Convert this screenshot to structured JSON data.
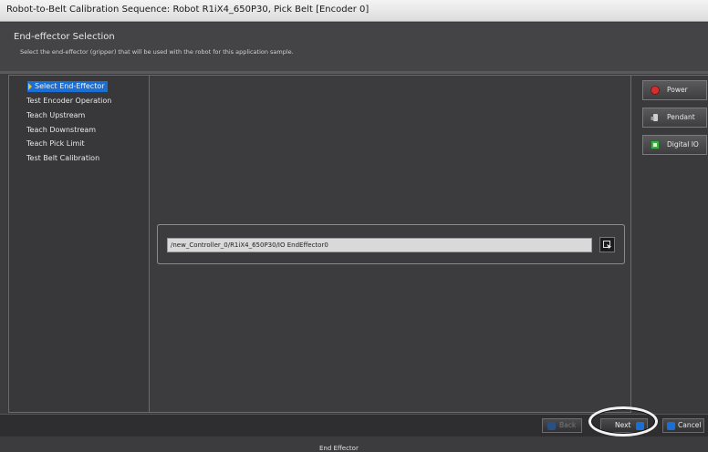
{
  "window": {
    "title": "Robot-to-Belt Calibration Sequence: Robot R1iX4_650P30, Pick Belt [Encoder 0]"
  },
  "header": {
    "title": "End-effector Selection",
    "description": "Select the end-effector (gripper) that will be used with the robot for this application sample."
  },
  "steps": [
    {
      "label": "Select End-Effector",
      "selected": true
    },
    {
      "label": "Test Encoder Operation",
      "selected": false
    },
    {
      "label": "Teach Upstream",
      "selected": false
    },
    {
      "label": "Teach Downstream",
      "selected": false
    },
    {
      "label": "Teach Pick Limit",
      "selected": false
    },
    {
      "label": "Test Belt Calibration",
      "selected": false
    }
  ],
  "end_effector": {
    "group_label": "End Effector",
    "value": "/new_Controller_0/R1iX4_650P30/IO EndEffector0",
    "browse_icon": "browse-icon"
  },
  "side_buttons": {
    "power": {
      "label": "Power",
      "icon": "power-icon",
      "color": "#d03030"
    },
    "pendant": {
      "label": "Pendant",
      "icon": "pendant-icon"
    },
    "digital_io": {
      "label": "Digital IO",
      "icon": "digital-io-icon",
      "color": "#3cb040"
    }
  },
  "footer": {
    "back_label": "Back",
    "next_label": "Next",
    "cancel_label": "Cancel",
    "accent_color": "#1a6fd6"
  }
}
